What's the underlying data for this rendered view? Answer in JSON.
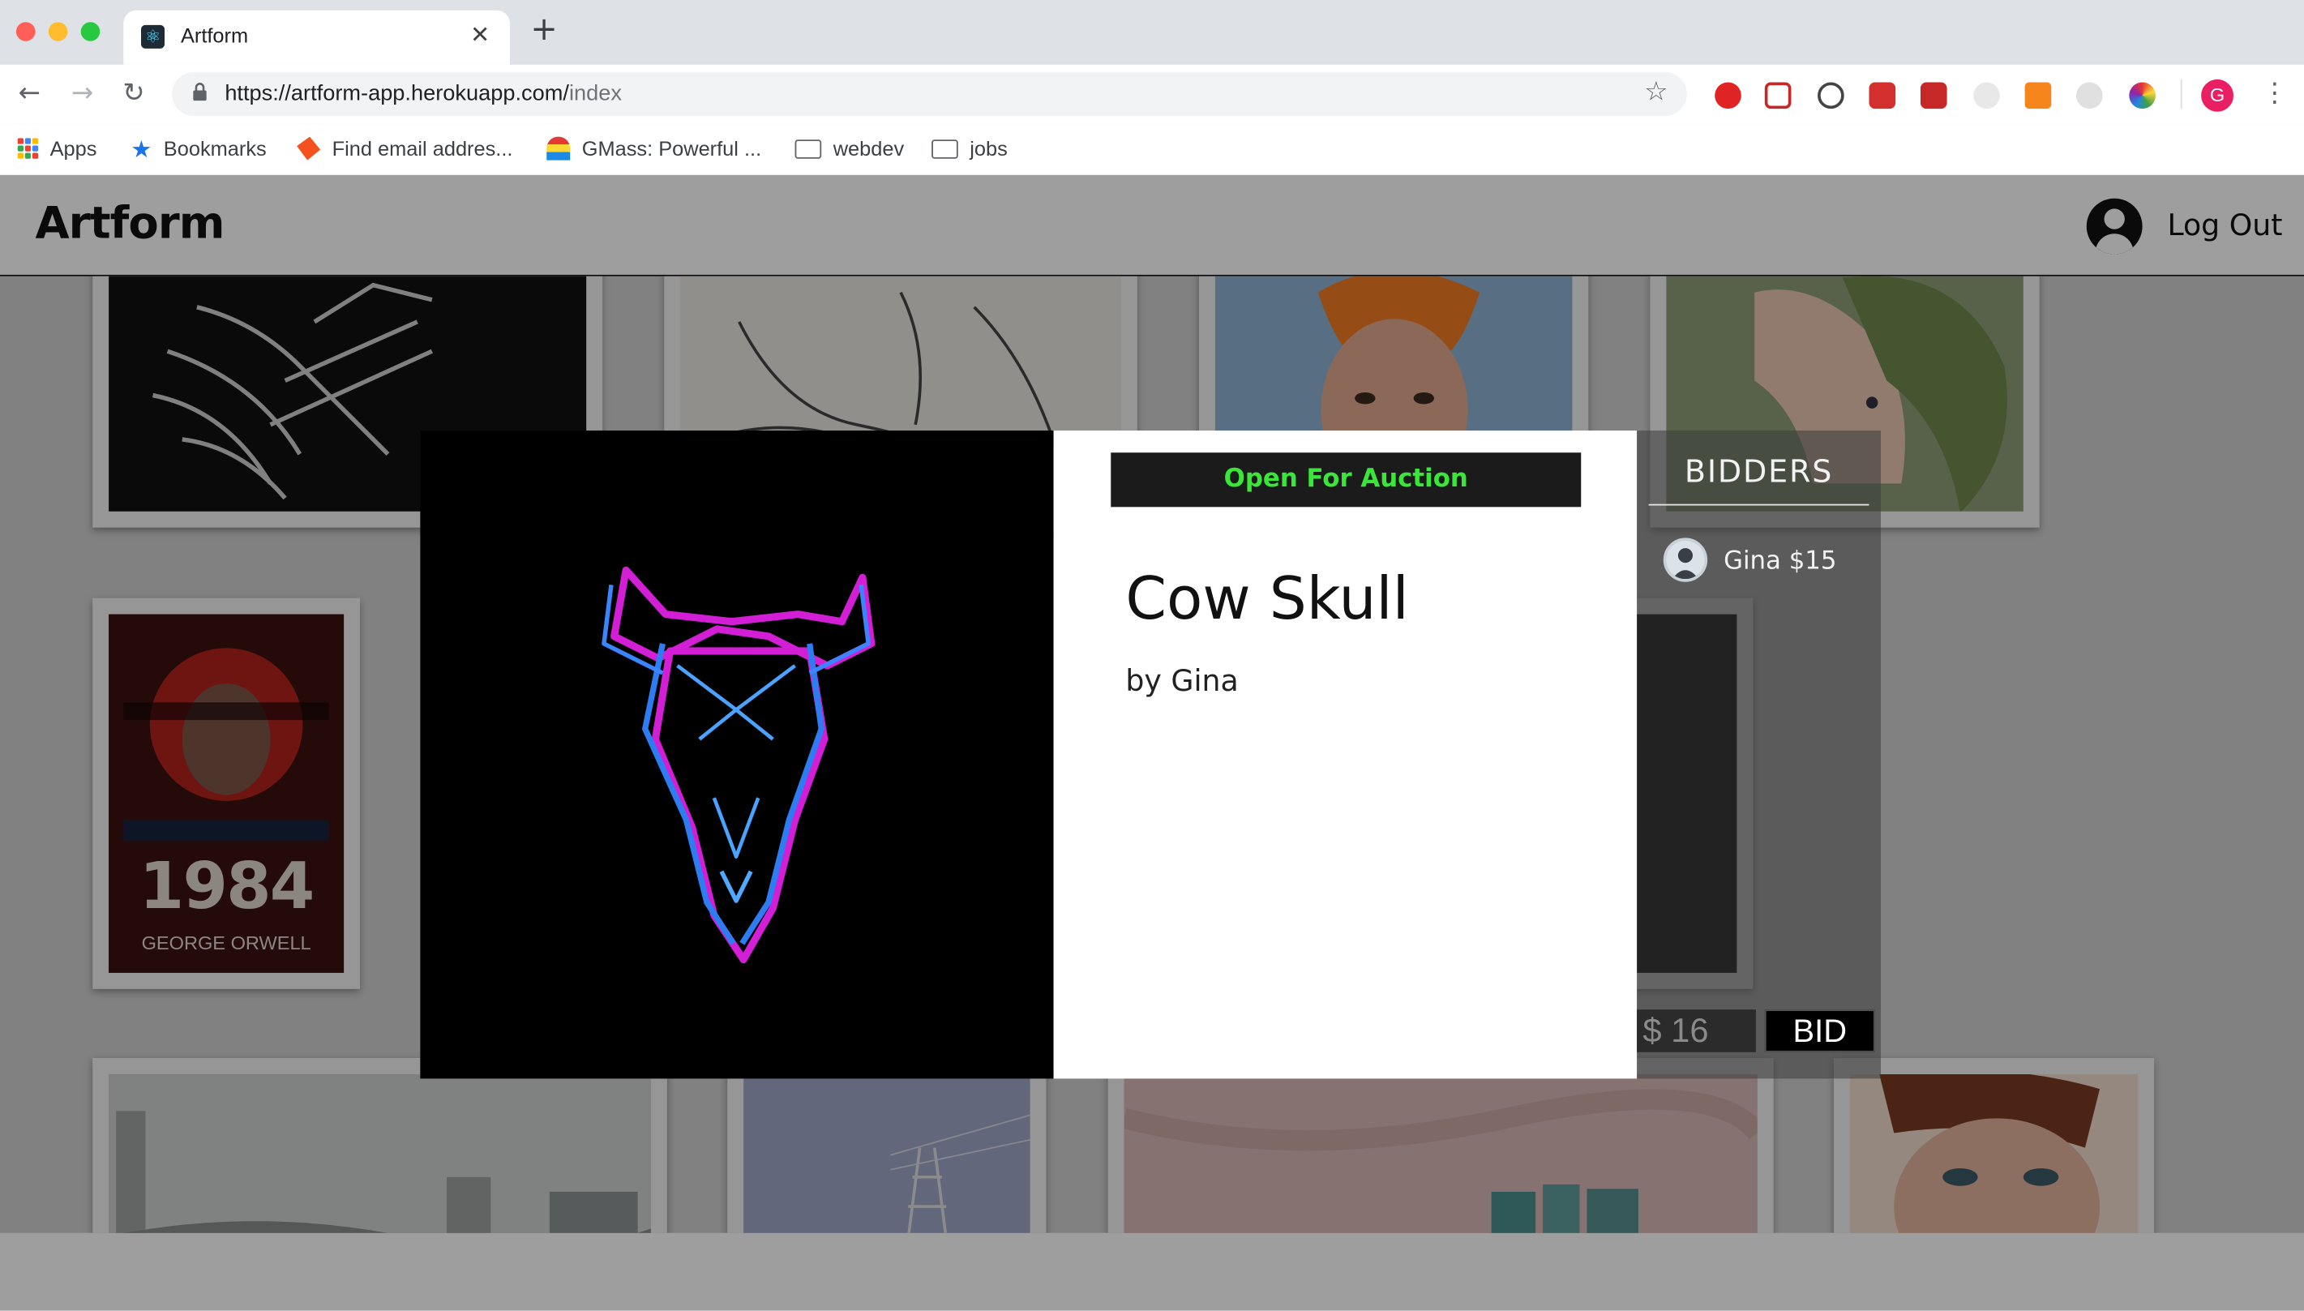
{
  "browser": {
    "tab_title": "Artform",
    "tab_close": "✕",
    "new_tab": "+",
    "url_host": "https://artform-app.herokuapp.com/",
    "url_path": "index",
    "profile_initial": "G",
    "bookmarks": [
      {
        "label": "Apps"
      },
      {
        "label": "Bookmarks"
      },
      {
        "label": "Find email addres..."
      },
      {
        "label": "GMass: Powerful ..."
      },
      {
        "label": "webdev"
      },
      {
        "label": "jobs"
      }
    ]
  },
  "header": {
    "brand": "Artform",
    "logout_label": "Log Out"
  },
  "modal": {
    "status": "Open For Auction",
    "title": "Cow Skull",
    "artist": "by Gina",
    "bidders_title": "BIDDERS",
    "bidders": [
      {
        "text": "Gina $15"
      }
    ],
    "bid_input_value": "$ 16",
    "bid_button": "BID"
  },
  "poster": {
    "number": "1984",
    "author": "GEORGE ORWELL"
  },
  "colors": {
    "status_green": "#39e639",
    "accent_dark": "#111111"
  }
}
